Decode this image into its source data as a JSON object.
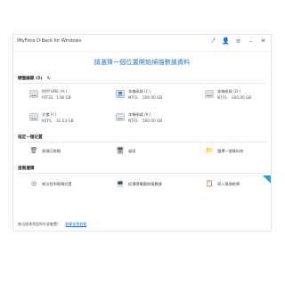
{
  "window": {
    "title": "iMyFone D-Back for Windows",
    "controls": [
      {
        "name": "share-icon",
        "glyph": "⤤"
      },
      {
        "name": "user-icon",
        "glyph": "👤"
      },
      {
        "name": "menu-icon",
        "glyph": "≡"
      },
      {
        "name": "minimize-icon",
        "glyph": "–"
      },
      {
        "name": "close-icon",
        "glyph": "✕"
      }
    ]
  },
  "heading": "請選擇一個位置開始掃描數據資料",
  "hard_drives": {
    "title": "硬盤磁碟",
    "count": "(5)",
    "refresh_glyph": "↻",
    "items": [
      {
        "name": "IMYFONE (H:)",
        "fs": "FAT32",
        "size": "1.96 GB",
        "system": false
      },
      {
        "name": "本機磁碟 (C:)",
        "fs": "NTFS",
        "size": "200.00 GB",
        "system": true
      },
      {
        "name": "本機磁碟 (D:)",
        "fs": "NTFS",
        "size": "200.00 GB",
        "system": false
      },
      {
        "name": "文檔 (F:)",
        "fs": "NTFS",
        "size": "31.53 GB",
        "system": false
      },
      {
        "name": "本機磁碟 (E:)",
        "fs": "NTFS",
        "size": "500.00 GB",
        "system": false
      }
    ]
  },
  "specific_location": {
    "title": "指定一個位置",
    "items": [
      {
        "label": "資源回收桶",
        "glyph": "🗑"
      },
      {
        "label": "桌面",
        "glyph": "🖥"
      },
      {
        "label": "選擇一個資料夾",
        "glyph": "📁"
      }
    ]
  },
  "advanced": {
    "title": "進階選擇",
    "items": [
      {
        "label": "無法找到現場位置",
        "glyph": "◎"
      },
      {
        "label": "從損壞電腦恢復數據",
        "glyph": "💻"
      },
      {
        "label": "導入掃描結果",
        "glyph": "📋"
      }
    ]
  },
  "footer": {
    "text": "無法偵測到您的外部裝置？",
    "link": "點擊這裡查看"
  },
  "colors": {
    "accent": "#2a7ad5",
    "heading": "#2a6fc4",
    "corner": "#2ba1d6"
  }
}
